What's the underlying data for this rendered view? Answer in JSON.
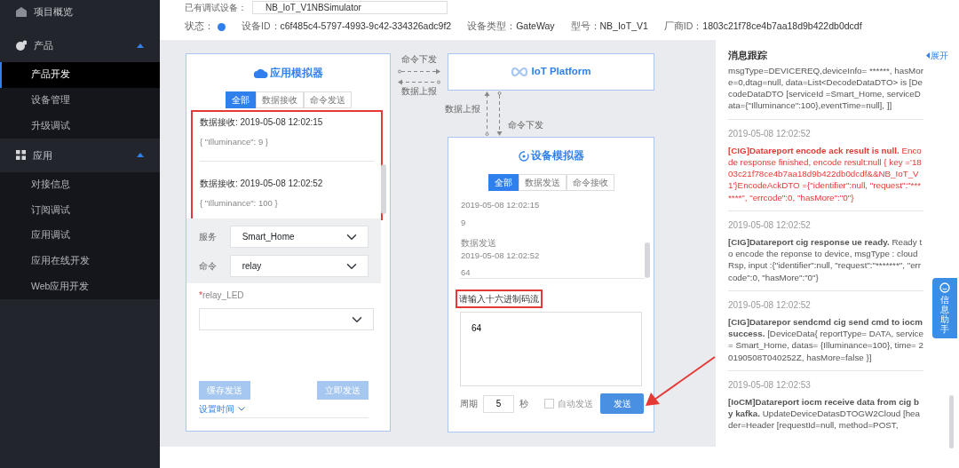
{
  "sidebar": {
    "items": [
      {
        "kind": "link",
        "label": "项目概览"
      },
      {
        "kind": "group",
        "label": "产品",
        "expanded": true,
        "children": [
          {
            "label": "产品开发",
            "selected": true
          },
          {
            "label": "设备管理",
            "selected": false
          },
          {
            "label": "升级调试",
            "selected": false
          }
        ]
      },
      {
        "kind": "group",
        "label": "应用",
        "expanded": true,
        "children": [
          {
            "label": "对接信息",
            "selected": false
          },
          {
            "label": "订阅调试",
            "selected": false
          },
          {
            "label": "应用调试",
            "selected": false
          },
          {
            "label": "应用在线开发",
            "selected": false
          },
          {
            "label": "Web应用开发",
            "selected": false
          }
        ]
      }
    ]
  },
  "header": {
    "device_label": "已有调试设备：",
    "device_value": "NB_IoT_V1NBSimulator",
    "status_label": "状态：",
    "fields": [
      {
        "label": "设备ID：",
        "value": "c6f485c4-5797-4993-9c42-334326adc9f2"
      },
      {
        "label": "设备类型：",
        "value": "GateWay"
      },
      {
        "label": "型号：",
        "value": "NB_IoT_V1"
      },
      {
        "label": "厂商ID：",
        "value": "1803c21f78ce4b7aa18d9b422db0dcdf"
      }
    ]
  },
  "app_simulator": {
    "title": "应用模拟器",
    "highlighted": true,
    "tabs": [
      {
        "label": "全部",
        "selected": true
      },
      {
        "label": "数据接收",
        "selected": false
      },
      {
        "label": "命令发送",
        "selected": false
      }
    ],
    "log": [
      {
        "title": "数据接收: 2019-05-08 12:02:15",
        "body": "{ \"Illuminance\": 9 }"
      },
      {
        "title": "数据接收: 2019-05-08 12:02:52",
        "body": "{ \"Illuminance\": 100 }"
      }
    ],
    "service_label": "服务",
    "service_value": "Smart_Home",
    "command_label": "命令",
    "command_value": "relay",
    "param_required_mark": "*",
    "param_label": "relay_LED",
    "buttons": [
      {
        "label": "缓存发送",
        "disabled": true
      },
      {
        "label": "立即发送",
        "disabled": true
      }
    ],
    "schedule_link": "设置时间"
  },
  "connectors": {
    "horizontal_top": "命令下发",
    "horizontal_bottom": "数据上报",
    "vertical_left": "数据上报",
    "vertical_right": "命令下发"
  },
  "platform": {
    "title": "IoT Platform"
  },
  "device_simulator": {
    "title": "设备模拟器",
    "tabs": [
      {
        "label": "全部",
        "selected": true
      },
      {
        "label": "数据发送",
        "selected": false
      },
      {
        "label": "命令接收",
        "selected": false
      }
    ],
    "log": [
      {
        "lines": [
          "2019-05-08 12:02:15"
        ],
        "value": "9"
      },
      {
        "lines": [
          "数据发送",
          "2019-05-08 12:02:52"
        ],
        "value": "64"
      }
    ],
    "input_label": "请输入十六进制码流",
    "input_highlighted": true,
    "input_value": "64",
    "period_label": "周期",
    "period_value": "5",
    "period_unit": "秒",
    "auto_send": {
      "label": "自动发送",
      "checked": false
    },
    "send_button": "发送"
  },
  "message_trace": {
    "title": "消息跟踪",
    "expand_link": "展开",
    "messages": [
      {
        "kind": "normal",
        "text": "msgType=DEVICEREQ,deviceInfo= ******, hasMore=0,dtag=null, data=List<DecodeDataDTO> is [DecodeDataDTO [serviceId =Smart_Home, serviceData={\"Illuminance\":100},eventTime=null], ]]"
      },
      {
        "kind": "error",
        "time": "2019-05-08 12:02:52",
        "title": "[CIG]Datareport encode ack result is null.",
        "text": "Encode response finished, encode result:null { key ='1803c21f78ce4b7aa18d9b422db0dcdf&&NB_IoT_V1'}EncodeAckDTO ={\"identifier\":null, \"request\":\"*******\", \"errcode\":0, \"hasMore\":\"0\"}"
      },
      {
        "kind": "normal",
        "time": "2019-05-08 12:02:52",
        "title": "[CIG]Datareport cig response ue ready.",
        "text": "Ready to encode the reponse to device, msgType : cloudRsp, input :{\"identifier\":null, \"request\":\"*******\", \"errcode\":0, \"hasMore\":\"0\"}"
      },
      {
        "kind": "normal",
        "time": "2019-05-08 12:02:52",
        "title": "[CIG]Datarepor sendcmd cig send cmd to iocm success.",
        "text": "[DeviceData{ reportType= DATA, service= Smart_Home, datas= {Illuminance=100}, time= 20190508T040252Z, hasMore=false }]"
      },
      {
        "kind": "normal",
        "time": "2019-05-08 12:02:53",
        "title": "[IoCM]Datareport iocm receive data from cig by kafka.",
        "text": "UpdateDeviceDatasDTOGW2Cloud [header=Header [requestId=null, method=POST,"
      }
    ]
  },
  "helper_tab": "信息助手"
}
